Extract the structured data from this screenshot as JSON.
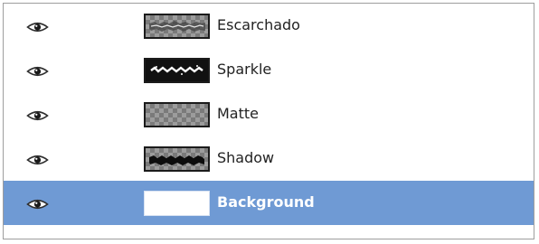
{
  "layers": [
    {
      "name": "Escarchado",
      "visible": true,
      "selected": false,
      "thumb": "escarchado"
    },
    {
      "name": "Sparkle",
      "visible": true,
      "selected": false,
      "thumb": "sparkle"
    },
    {
      "name": "Matte",
      "visible": true,
      "selected": false,
      "thumb": "matte"
    },
    {
      "name": "Shadow",
      "visible": true,
      "selected": false,
      "thumb": "shadow"
    },
    {
      "name": "Background",
      "visible": true,
      "selected": true,
      "thumb": "background"
    }
  ],
  "colors": {
    "selection": "#6f9ad4",
    "text": "#222222",
    "selected_text": "#ffffff"
  }
}
